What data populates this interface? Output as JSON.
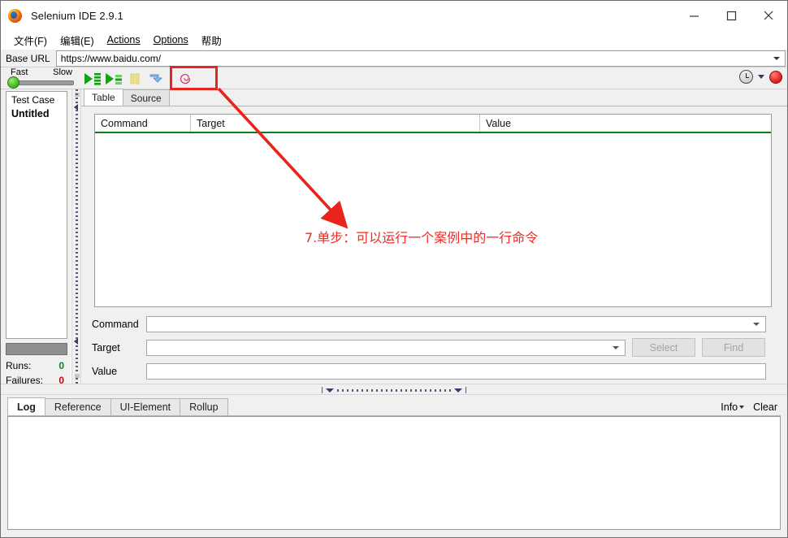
{
  "window": {
    "title": "Selenium IDE 2.9.1",
    "app_icon": "firefox-icon",
    "minimize_label": "—",
    "maximize_label": "□",
    "close_label": "✕"
  },
  "menu": {
    "items": [
      {
        "label": "文件(F)",
        "mnemonic": "F"
      },
      {
        "label": "编辑(E)",
        "mnemonic": "E"
      },
      {
        "label": "Actions",
        "mnemonic": "A"
      },
      {
        "label": "Options",
        "mnemonic": "O"
      },
      {
        "label": "帮助",
        "mnemonic": ""
      }
    ]
  },
  "base_url": {
    "label": "Base URL",
    "value": "https://www.baidu.com/",
    "placeholder": "",
    "dropdown_icon": "chevron-down-icon"
  },
  "toolbar": {
    "speed": {
      "fast_label": "Fast",
      "slow_label": "Slow",
      "position": "fast"
    },
    "buttons": [
      {
        "name": "play-entire-test-suite",
        "icon": "play-suite-icon"
      },
      {
        "name": "play-current-test-case",
        "icon": "play-case-icon"
      },
      {
        "name": "pause-resume",
        "icon": "pause-icon",
        "enabled": false
      },
      {
        "name": "step",
        "icon": "step-arrow-icon"
      },
      {
        "name": "apply-rollup-rules",
        "icon": "rollup-spiral-icon"
      }
    ],
    "right": {
      "schedule_icon": "clock-icon",
      "dropdown_icon": "chevron-down-icon",
      "record_icon": "record-dot-icon"
    }
  },
  "left_pane": {
    "header": "Test Case",
    "items": [
      {
        "label": "Untitled",
        "selected": true
      }
    ],
    "progress_percent": 0,
    "stats": [
      {
        "label": "Runs:",
        "value": "0",
        "color": "#0a7f28"
      },
      {
        "label": "Failures:",
        "value": "0",
        "color": "#d50000"
      }
    ]
  },
  "editor": {
    "tabs": [
      {
        "label": "Table",
        "active": true
      },
      {
        "label": "Source",
        "active": false
      }
    ],
    "table": {
      "columns": [
        "Command",
        "Target",
        "Value"
      ],
      "rows": [],
      "header_underline_color": "#0a7f1f"
    },
    "form": {
      "command": {
        "label": "Command",
        "value": "",
        "placeholder": "",
        "dropdown_icon": "chevron-down-icon"
      },
      "target": {
        "label": "Target",
        "value": "",
        "placeholder": "",
        "dropdown_icon": "chevron-down-icon"
      },
      "value": {
        "label": "Value",
        "value": "",
        "placeholder": ""
      },
      "select_button": {
        "label": "Select",
        "enabled": false
      },
      "find_button": {
        "label": "Find",
        "enabled": false
      }
    }
  },
  "log_panel": {
    "tabs": [
      {
        "label": "Log",
        "active": true
      },
      {
        "label": "Reference",
        "active": false
      },
      {
        "label": "UI-Element",
        "active": false
      },
      {
        "label": "Rollup",
        "active": false
      }
    ],
    "info_label": "Info",
    "clear_label": "Clear",
    "content": ""
  },
  "annotation": {
    "text": "7.单步：可以运行一个案例中的一行命令",
    "color": "#ee2a22",
    "highlight_target": "step-button"
  }
}
